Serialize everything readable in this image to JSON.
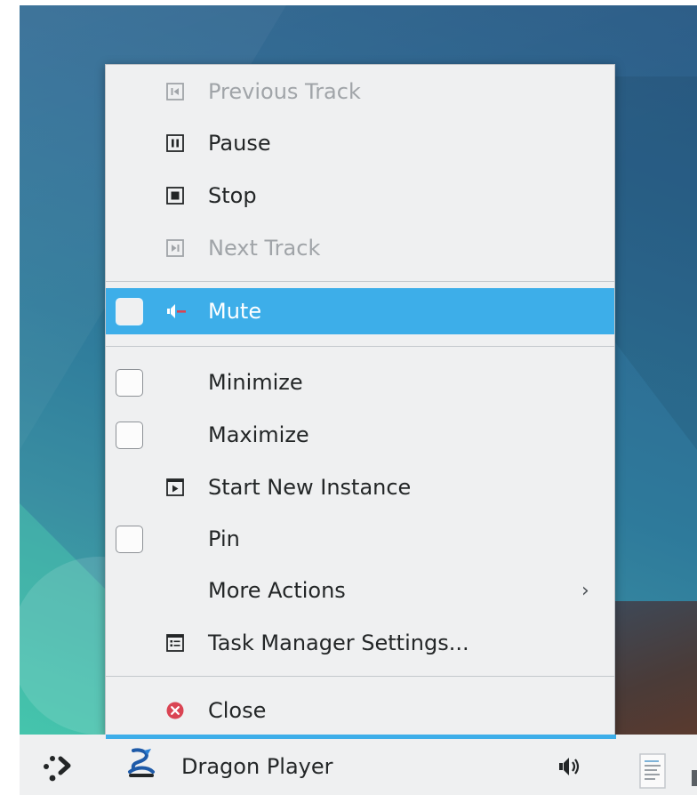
{
  "menu": {
    "media_items": [
      {
        "label": "Previous Track",
        "icon": "previous-track-icon",
        "enabled": false
      },
      {
        "label": "Pause",
        "icon": "pause-icon",
        "enabled": true
      },
      {
        "label": "Stop",
        "icon": "stop-icon",
        "enabled": true
      },
      {
        "label": "Next Track",
        "icon": "next-track-icon",
        "enabled": false
      }
    ],
    "mute": {
      "label": "Mute",
      "icon": "muted-speaker-icon",
      "checked": false,
      "highlighted": true
    },
    "window_items": [
      {
        "label": "Minimize",
        "checkbox": true,
        "checked": false
      },
      {
        "label": "Maximize",
        "checkbox": true,
        "checked": false
      },
      {
        "label": "Start New Instance",
        "icon": "start-instance-icon"
      },
      {
        "label": "Pin",
        "checkbox": true,
        "checked": false
      },
      {
        "label": "More Actions",
        "submenu": true,
        "icon": "chevron-right-icon"
      },
      {
        "label": "Task Manager Settings...",
        "icon": "settings-list-icon"
      }
    ],
    "close": {
      "label": "Close",
      "icon": "close-circle-icon"
    }
  },
  "taskbar": {
    "launcher_icon": "app-launcher-icon",
    "active_task": {
      "title": "Dragon Player",
      "icon": "dragon-player-icon"
    },
    "tray_icons": [
      "speaker-volume-icon",
      "document-icon"
    ]
  },
  "colors": {
    "highlight": "#3daee9",
    "menu_bg": "#eff0f1",
    "close_red": "#da4453",
    "mute_red": "#da4453"
  }
}
